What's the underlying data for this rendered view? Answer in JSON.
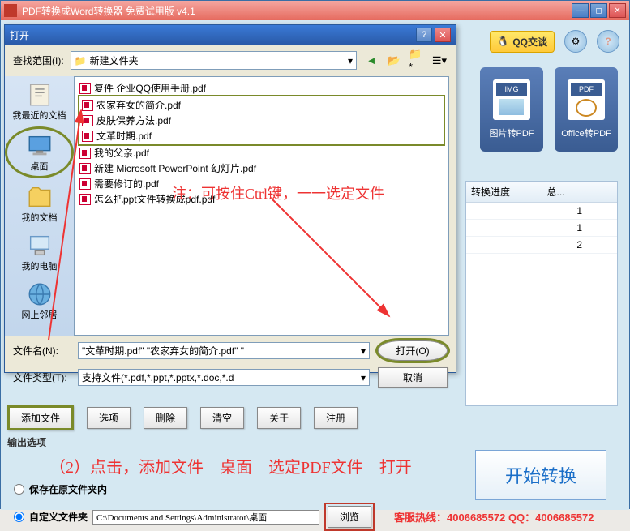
{
  "main": {
    "title": "PDF转换成Word转换器 免费试用版 v4.1",
    "qq": "QQ交谈",
    "tiles": {
      "img_badge": "IMG",
      "pdf_badge": "PDF",
      "img_label": "图片转PDF",
      "pdf_label": "Office转PDF"
    },
    "progress": {
      "col1": "转换进度",
      "col2": "总...",
      "rows": [
        "1",
        "1",
        "2"
      ]
    },
    "buttons": {
      "add": "添加文件",
      "options": "选项",
      "delete": "删除",
      "clear": "清空",
      "about": "关于",
      "register": "注册"
    },
    "output_label": "输出选项",
    "instr": "（2）点击，添加文件—桌面—选定PDF文件—打开",
    "start": "开始转换",
    "save_orig": "保存在原文件夹内",
    "custom_folder": "自定义文件夹",
    "path": "C:\\Documents and Settings\\Administrator\\桌面",
    "browse": "浏览",
    "hotline": "客服热线：4006685572 QQ：4006685572"
  },
  "dialog": {
    "title": "打开",
    "lookin_label": "查找范围(I):",
    "lookin_value": "新建文件夹",
    "places": {
      "recent": "我最近的文档",
      "desktop": "桌面",
      "mydocs": "我的文档",
      "mycomp": "我的电脑",
      "network": "网上邻居"
    },
    "files": [
      "复件 企业QQ使用手册.pdf",
      "农家弃女的简介.pdf",
      "皮肤保养方法.pdf",
      "文革时期.pdf",
      "我的父亲.pdf",
      "新建 Microsoft PowerPoint 幻灯片.pdf",
      "需要修订的.pdf",
      "怎么把ppt文件转换成pdf.pdf"
    ],
    "filename_label": "文件名(N):",
    "filename_value": "\"文革时期.pdf\" \"农家弃女的简介.pdf\" \"",
    "filetype_label": "文件类型(T):",
    "filetype_value": "支持文件(*.pdf,*.ppt,*.pptx,*.doc,*.d",
    "open_btn": "打开(O)",
    "cancel_btn": "取消"
  },
  "annotation": {
    "note": "注：可按住Ctrl键，一一选定文件"
  }
}
